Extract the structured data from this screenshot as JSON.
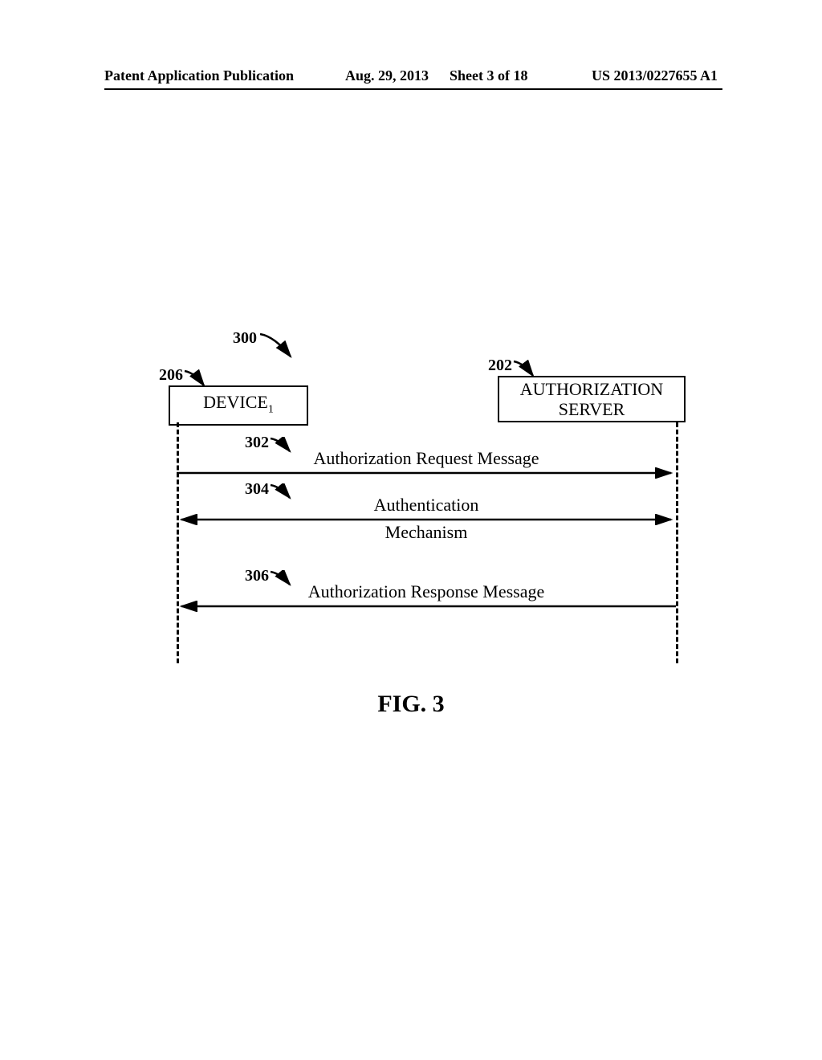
{
  "header": {
    "publication_type": "Patent Application Publication",
    "date": "Aug. 29, 2013",
    "sheet": "Sheet 3 of 18",
    "pub_number": "US 2013/0227655 A1"
  },
  "diagram": {
    "overall_ref": "300",
    "left_entity_ref": "206",
    "right_entity_ref": "202",
    "left_entity": {
      "name": "DEVICE",
      "subscript": "1"
    },
    "right_entity": {
      "line1": "AUTHORIZATION",
      "line2": "SERVER"
    },
    "messages": [
      {
        "ref": "302",
        "label": "Authorization Request Message",
        "direction": "right"
      },
      {
        "ref": "304",
        "label_top": "Authentication",
        "label_bottom": "Mechanism",
        "direction": "both"
      },
      {
        "ref": "306",
        "label": "Authorization Response Message",
        "direction": "left"
      }
    ],
    "caption": "FIG. 3"
  }
}
